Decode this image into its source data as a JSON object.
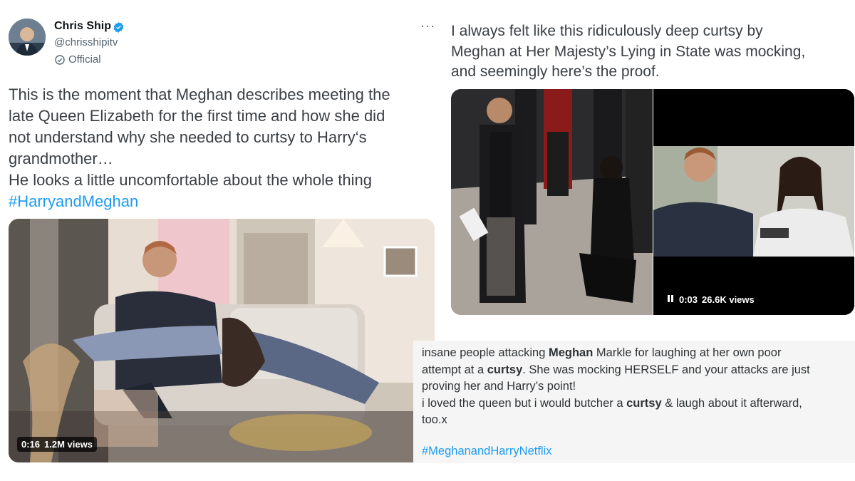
{
  "tweet1": {
    "author_name": "Chris Ship",
    "handle": "@chrisshipitv",
    "official_label": "Official",
    "more_label": "···",
    "text_lines": [
      "This is the moment that Meghan describes meeting the",
      "late Queen Elizabeth for the first time and how she did",
      "not understand why she needed to curtsy to Harry‘s",
      "grandmother…",
      "He looks a little uncomfortable about the whole thing"
    ],
    "hashtag": "#HarryandMeghan",
    "video": {
      "duration": "0:16",
      "views": "1.2M views"
    }
  },
  "tweet2": {
    "text_lines": [
      "I always felt like this ridiculously deep curtsy by",
      "Meghan at Her Majesty’s Lying in State was mocking,",
      "and seemingly here’s the proof."
    ],
    "video": {
      "pause_icon": "pause-icon",
      "duration": "0:03",
      "views": "26.6K views"
    }
  },
  "tweet3": {
    "line1_pre": "insane people attacking ",
    "line1_bold": "Meghan",
    "line1_post": " Markle for laughing at her own poor",
    "line2_pre": "attempt at a ",
    "line2_bold": "curtsy",
    "line2_post": ". She was mocking HERSELF and your attacks are just",
    "line3": "proving her and Harry’s point!",
    "line4_pre": "i loved the queen but i would butcher a ",
    "line4_bold": "curtsy",
    "line4_post": " & laugh about it afterward,",
    "line5": "too.x",
    "hashtag": "#MeghanandHarryNetflix"
  },
  "colors": {
    "link": "#1d9bf0",
    "verified": "#1d9bf0",
    "text": "#3a3f44",
    "muted": "#536471"
  }
}
